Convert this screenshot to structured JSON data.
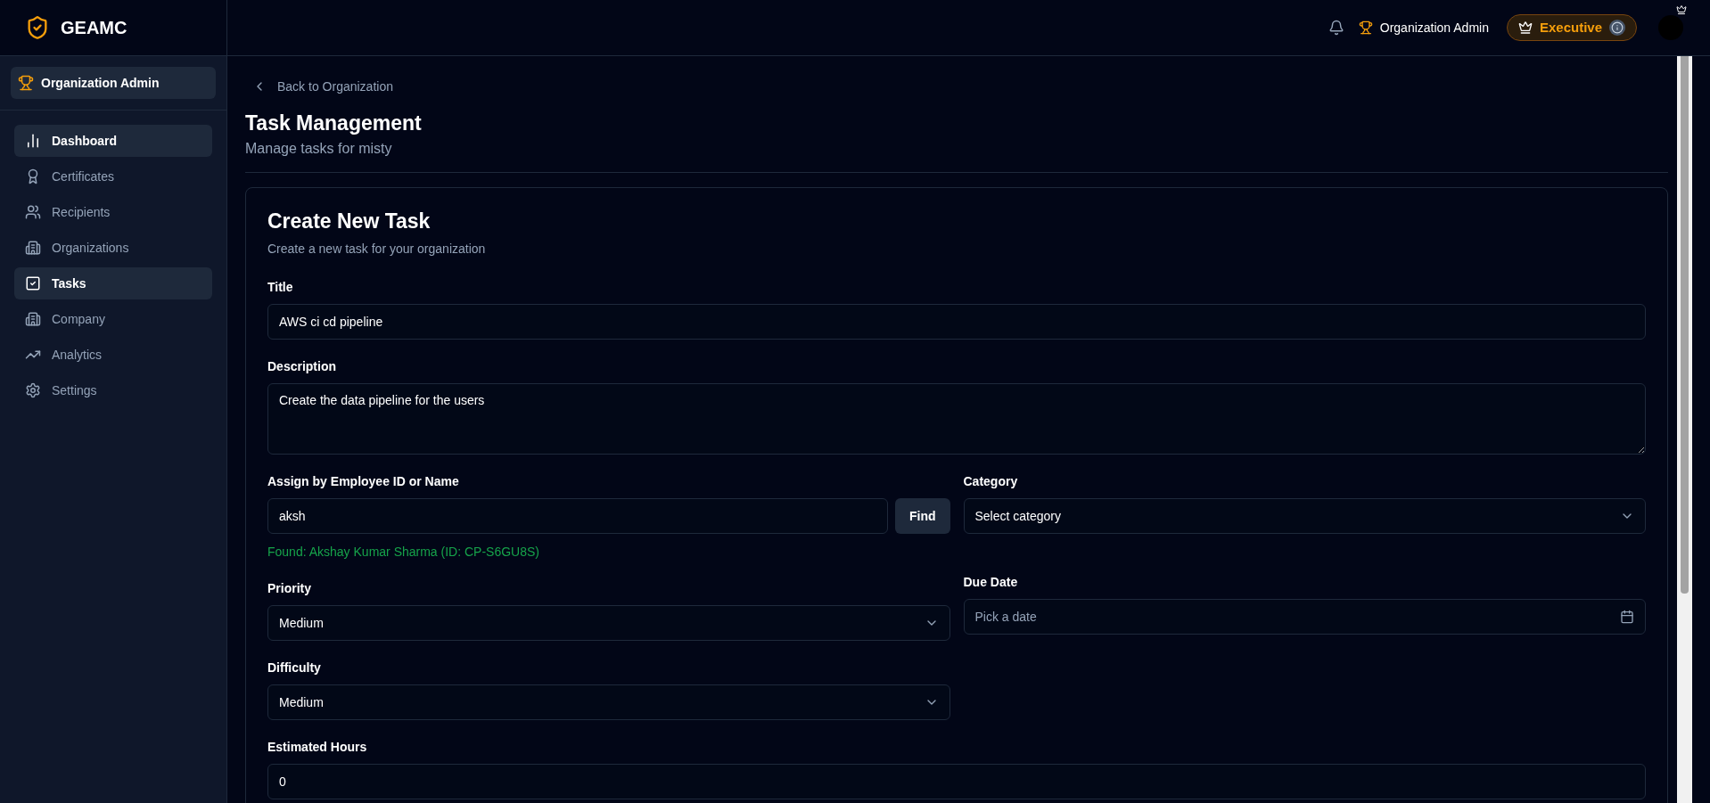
{
  "brand": {
    "name": "GEAMC"
  },
  "sidebar": {
    "role": "Organization Admin",
    "items": [
      {
        "label": "Dashboard",
        "selected": true
      },
      {
        "label": "Certificates",
        "selected": false
      },
      {
        "label": "Recipients",
        "selected": false
      },
      {
        "label": "Organizations",
        "selected": false
      },
      {
        "label": "Tasks",
        "selected": true
      },
      {
        "label": "Company",
        "selected": false
      },
      {
        "label": "Analytics",
        "selected": false
      },
      {
        "label": "Settings",
        "selected": false
      }
    ]
  },
  "header": {
    "role": "Organization Admin",
    "tier": "Executive"
  },
  "back_link": "Back to Organization",
  "page": {
    "title": "Task Management",
    "subtitle": "Manage tasks for misty"
  },
  "form": {
    "title": "Create New Task",
    "subtitle": "Create a new task for your organization",
    "task_title": {
      "label": "Title",
      "value": "AWS ci cd pipeline"
    },
    "description": {
      "label": "Description",
      "value": "Create the data pipeline for the users"
    },
    "assign": {
      "label": "Assign by Employee ID or Name",
      "value": "aksh",
      "button": "Find",
      "result": "Found: Akshay Kumar Sharma (ID: CP-S6GU8S)"
    },
    "category": {
      "label": "Category",
      "value": "Select category"
    },
    "priority": {
      "label": "Priority",
      "value": "Medium"
    },
    "due_date": {
      "label": "Due Date",
      "placeholder": "Pick a date"
    },
    "difficulty": {
      "label": "Difficulty",
      "value": "Medium"
    },
    "estimated_hours": {
      "label": "Estimated Hours",
      "value": "0"
    }
  }
}
